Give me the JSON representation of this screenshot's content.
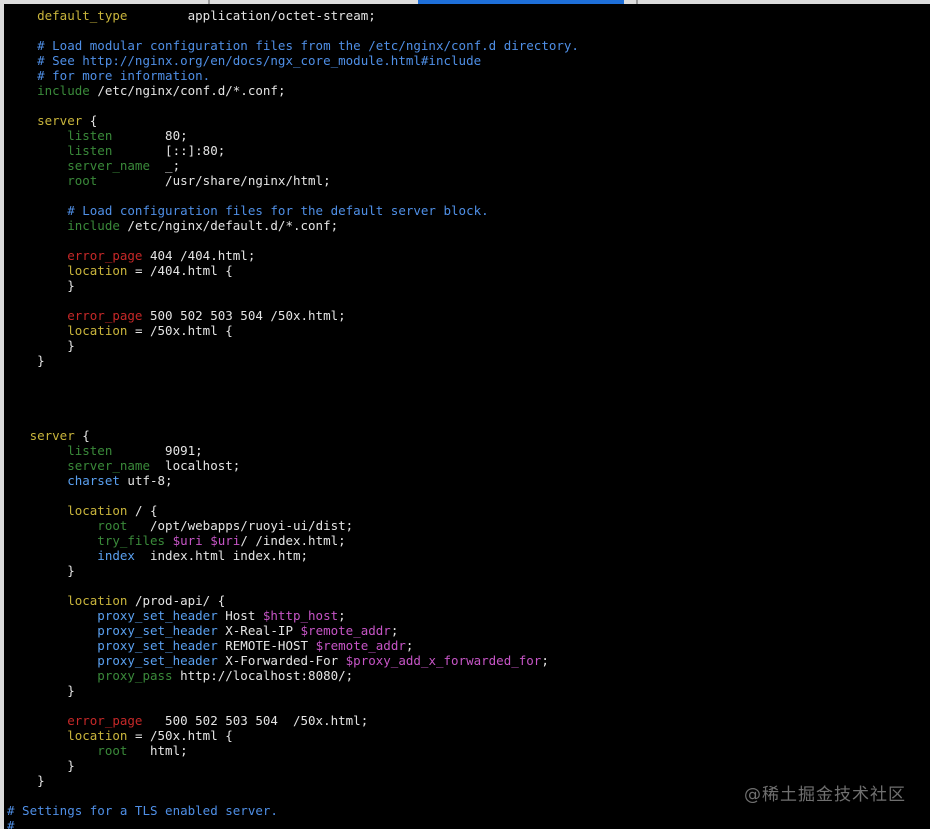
{
  "colors": {
    "background": "#000000",
    "default": "#e4e4e4",
    "comment": "#4f8fe6",
    "directive": "#3a8a3a",
    "keyword": "#c9b53c",
    "blue_directive": "#5aa0f0",
    "error_directive": "#c62828",
    "variable": "#c655c6",
    "tab_active": "#1e6fd9",
    "chrome": "#dcdcdc"
  },
  "window": {
    "active_tab_indicator": "active-tab"
  },
  "code_lines": [
    [
      {
        "t": "    default_type        ",
        "c": "keyword"
      },
      {
        "t": "application/octet-stream;",
        "c": "default"
      }
    ],
    [
      {
        "t": "",
        "c": "default"
      }
    ],
    [
      {
        "t": "    # Load modular configuration files from the /etc/nginx/conf.d directory.",
        "c": "comment"
      }
    ],
    [
      {
        "t": "    # See http://nginx.org/en/docs/ngx_core_module.html#include",
        "c": "comment"
      }
    ],
    [
      {
        "t": "    # for more information.",
        "c": "comment"
      }
    ],
    [
      {
        "t": "    include",
        "c": "directive"
      },
      {
        "t": " /etc/nginx/conf.d/*.conf;",
        "c": "default"
      }
    ],
    [
      {
        "t": "",
        "c": "default"
      }
    ],
    [
      {
        "t": "    server",
        "c": "keyword"
      },
      {
        "t": " {",
        "c": "default"
      }
    ],
    [
      {
        "t": "        listen",
        "c": "directive"
      },
      {
        "t": "       80;",
        "c": "default"
      }
    ],
    [
      {
        "t": "        listen",
        "c": "directive"
      },
      {
        "t": "       [::]:80;",
        "c": "default"
      }
    ],
    [
      {
        "t": "        server_name",
        "c": "directive"
      },
      {
        "t": "  _;",
        "c": "default"
      }
    ],
    [
      {
        "t": "        root",
        "c": "directive"
      },
      {
        "t": "         /usr/share/nginx/html;",
        "c": "default"
      }
    ],
    [
      {
        "t": "",
        "c": "default"
      }
    ],
    [
      {
        "t": "        # Load configuration files for the default server block.",
        "c": "comment"
      }
    ],
    [
      {
        "t": "        include",
        "c": "directive"
      },
      {
        "t": " /etc/nginx/default.d/*.conf;",
        "c": "default"
      }
    ],
    [
      {
        "t": "",
        "c": "default"
      }
    ],
    [
      {
        "t": "        error_page",
        "c": "error_directive"
      },
      {
        "t": " 404 /404.html;",
        "c": "default"
      }
    ],
    [
      {
        "t": "        location",
        "c": "keyword"
      },
      {
        "t": " = /404.html {",
        "c": "default"
      }
    ],
    [
      {
        "t": "        }",
        "c": "default"
      }
    ],
    [
      {
        "t": "",
        "c": "default"
      }
    ],
    [
      {
        "t": "        error_page",
        "c": "error_directive"
      },
      {
        "t": " 500 502 503 504 /50x.html;",
        "c": "default"
      }
    ],
    [
      {
        "t": "        location",
        "c": "keyword"
      },
      {
        "t": " = /50x.html {",
        "c": "default"
      }
    ],
    [
      {
        "t": "        }",
        "c": "default"
      }
    ],
    [
      {
        "t": "    }",
        "c": "default"
      }
    ],
    [
      {
        "t": "",
        "c": "default"
      }
    ],
    [
      {
        "t": "",
        "c": "default"
      }
    ],
    [
      {
        "t": "",
        "c": "default"
      }
    ],
    [
      {
        "t": "",
        "c": "default"
      }
    ],
    [
      {
        "t": "   server",
        "c": "keyword"
      },
      {
        "t": " {",
        "c": "default"
      }
    ],
    [
      {
        "t": "        listen",
        "c": "directive"
      },
      {
        "t": "       9091;",
        "c": "default"
      }
    ],
    [
      {
        "t": "        server_name",
        "c": "directive"
      },
      {
        "t": "  localhost;",
        "c": "default"
      }
    ],
    [
      {
        "t": "        charset",
        "c": "blue_directive"
      },
      {
        "t": " utf-8;",
        "c": "default"
      }
    ],
    [
      {
        "t": "",
        "c": "default"
      }
    ],
    [
      {
        "t": "        location",
        "c": "keyword"
      },
      {
        "t": " / {",
        "c": "default"
      }
    ],
    [
      {
        "t": "            root",
        "c": "directive"
      },
      {
        "t": "   /opt/webapps/ruoyi-ui/dist;",
        "c": "default"
      }
    ],
    [
      {
        "t": "            try_files",
        "c": "directive"
      },
      {
        "t": " ",
        "c": "default"
      },
      {
        "t": "$uri",
        "c": "variable"
      },
      {
        "t": " ",
        "c": "default"
      },
      {
        "t": "$uri",
        "c": "variable"
      },
      {
        "t": "/ /index.html;",
        "c": "default"
      }
    ],
    [
      {
        "t": "            index",
        "c": "blue_directive"
      },
      {
        "t": "  index.html index.htm;",
        "c": "default"
      }
    ],
    [
      {
        "t": "        }",
        "c": "default"
      }
    ],
    [
      {
        "t": "",
        "c": "default"
      }
    ],
    [
      {
        "t": "        location",
        "c": "keyword"
      },
      {
        "t": " /prod-api/ {",
        "c": "default"
      }
    ],
    [
      {
        "t": "            proxy_set_header",
        "c": "blue_directive"
      },
      {
        "t": " Host ",
        "c": "default"
      },
      {
        "t": "$http_host",
        "c": "variable"
      },
      {
        "t": ";",
        "c": "default"
      }
    ],
    [
      {
        "t": "            proxy_set_header",
        "c": "blue_directive"
      },
      {
        "t": " X-Real-IP ",
        "c": "default"
      },
      {
        "t": "$remote_addr",
        "c": "variable"
      },
      {
        "t": ";",
        "c": "default"
      }
    ],
    [
      {
        "t": "            proxy_set_header",
        "c": "blue_directive"
      },
      {
        "t": " REMOTE-HOST ",
        "c": "default"
      },
      {
        "t": "$remote_addr",
        "c": "variable"
      },
      {
        "t": ";",
        "c": "default"
      }
    ],
    [
      {
        "t": "            proxy_set_header",
        "c": "blue_directive"
      },
      {
        "t": " X-Forwarded-For ",
        "c": "default"
      },
      {
        "t": "$proxy_add_x_forwarded_for",
        "c": "variable"
      },
      {
        "t": ";",
        "c": "default"
      }
    ],
    [
      {
        "t": "            proxy_pass",
        "c": "directive"
      },
      {
        "t": " http://localhost:8080/;",
        "c": "default"
      }
    ],
    [
      {
        "t": "        }",
        "c": "default"
      }
    ],
    [
      {
        "t": "",
        "c": "default"
      }
    ],
    [
      {
        "t": "        error_page",
        "c": "error_directive"
      },
      {
        "t": "   500 502 503 504  /50x.html;",
        "c": "default"
      }
    ],
    [
      {
        "t": "        location",
        "c": "keyword"
      },
      {
        "t": " = /50x.html {",
        "c": "default"
      }
    ],
    [
      {
        "t": "            root",
        "c": "directive"
      },
      {
        "t": "   html;",
        "c": "default"
      }
    ],
    [
      {
        "t": "        }",
        "c": "default"
      }
    ],
    [
      {
        "t": "    }",
        "c": "default"
      }
    ],
    [
      {
        "t": "",
        "c": "default"
      }
    ],
    [
      {
        "t": "# Settings for a TLS enabled server.",
        "c": "comment"
      }
    ],
    [
      {
        "t": "#",
        "c": "comment"
      }
    ]
  ],
  "watermark": "@稀土掘金技术社区"
}
